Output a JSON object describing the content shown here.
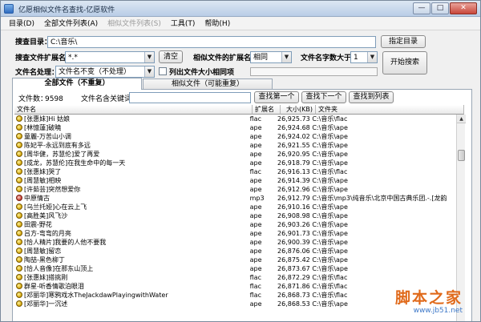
{
  "window": {
    "title": "亿愿相似文件名查找-亿愿软件",
    "min_label": "—",
    "max_label": "□",
    "close_label": "✕"
  },
  "menu": [
    {
      "label": "目录(D)",
      "enabled": true
    },
    {
      "label": "全部文件列表(A)",
      "enabled": true
    },
    {
      "label": "相似文件列表(S)",
      "enabled": false
    },
    {
      "label": "工具(T)",
      "enabled": true
    },
    {
      "label": "帮助(H)",
      "enabled": true
    }
  ],
  "form": {
    "search_dir_label": "搜查目录：",
    "search_dir_value": "C:\\音乐\\",
    "choose_dir_button": "指定目录",
    "ext_label": "搜查文件扩展名：",
    "ext_value": "*.*",
    "clear_button": "清空",
    "similar_ext_label": "相似文件的扩展名：",
    "similar_ext_value": "相同",
    "min_chars_label": "文件名字数大于：",
    "min_chars_value": "1",
    "start_button": "开始搜索",
    "name_proc_label": "文件名处理：",
    "name_proc_value": "文件名不变（不处理）",
    "list_same_size_label": "列出文件大小相同项",
    "list_same_size_checked": false,
    "progress": 0
  },
  "tabs": [
    {
      "label": "全部文件（不重复）",
      "active": true
    },
    {
      "label": "相似文件（可能重复）",
      "active": false
    }
  ],
  "list_info": {
    "file_count_label": "文件数：",
    "file_count_value": "9598",
    "keyword_label": "文件名含关键词：",
    "keyword_value": "",
    "find_first_button": "查找第一个",
    "find_next_button": "查找下一个",
    "find_to_list_button": "查找到列表"
  },
  "columns": [
    "文件名",
    "扩展名",
    "大小(KB)",
    "文件夹"
  ],
  "rows": [
    {
      "name": "[张惠妹]Hi 姑娘",
      "ext": "flac",
      "size": "26,925.73",
      "folder": "C:\\音乐\\flac",
      "type": "flac"
    },
    {
      "name": "[林憶蓮]破曉",
      "ext": "ape",
      "size": "26,924.68",
      "folder": "C:\\音乐\\ape",
      "type": "ape"
    },
    {
      "name": "童麗-万苦山小调",
      "ext": "ape",
      "size": "26,924.02",
      "folder": "C:\\音乐\\ape",
      "type": "ape"
    },
    {
      "name": "陈妃平-永远到底有多远",
      "ext": "ape",
      "size": "26,921.55",
      "folder": "C:\\音乐\\ape",
      "type": "ape"
    },
    {
      "name": "[周华健，苏慧伦]爱了再爱",
      "ext": "ape",
      "size": "26,920.95",
      "folder": "C:\\音乐\\ape",
      "type": "ape"
    },
    {
      "name": "[成龙，苏慧伦]在我生命中的每一天",
      "ext": "ape",
      "size": "26,918.79",
      "folder": "C:\\音乐\\ape",
      "type": "ape"
    },
    {
      "name": "[张惠妹]哭了",
      "ext": "flac",
      "size": "26,916.13",
      "folder": "C:\\音乐\\flac",
      "type": "flac"
    },
    {
      "name": "[周慧敏]相映",
      "ext": "ape",
      "size": "26,914.39",
      "folder": "C:\\音乐\\ape",
      "type": "ape"
    },
    {
      "name": "[许茹芸]突然想爱你",
      "ext": "ape",
      "size": "26,912.96",
      "folder": "C:\\音乐\\ape",
      "type": "ape"
    },
    {
      "name": "中原情古",
      "ext": "mp3",
      "size": "26,912.79",
      "folder": "C:\\音乐\\mp3\\纯音乐\\北京中国古典乐团.-.[龙韵",
      "type": "mp3"
    },
    {
      "name": "[乌兰托娅]心在云上飞",
      "ext": "ape",
      "size": "26,910.16",
      "folder": "C:\\音乐\\ape",
      "type": "ape"
    },
    {
      "name": "[高胜美]风飞沙",
      "ext": "ape",
      "size": "26,908.98",
      "folder": "C:\\音乐\\ape",
      "type": "ape"
    },
    {
      "name": "田震-野花",
      "ext": "ape",
      "size": "26,903.26",
      "folder": "C:\\音乐\\ape",
      "type": "ape"
    },
    {
      "name": "吕方-弯弯的月亮",
      "ext": "ape",
      "size": "26,901.73",
      "folder": "C:\\音乐\\ape",
      "type": "ape"
    },
    {
      "name": "[恰人精片]我要的人他不要我",
      "ext": "ape",
      "size": "26,900.39",
      "folder": "C:\\音乐\\ape",
      "type": "ape"
    },
    {
      "name": "[周慧敏]留恋",
      "ext": "ape",
      "size": "26,876.06",
      "folder": "C:\\音乐\\ape",
      "type": "ape"
    },
    {
      "name": "陶喆-黑色柳丁",
      "ext": "ape",
      "size": "26,875.42",
      "folder": "C:\\音乐\\ape",
      "type": "ape"
    },
    {
      "name": "[恰人音像]在那东山顶上",
      "ext": "ape",
      "size": "26,873.67",
      "folder": "C:\\音乐\\ape",
      "type": "ape"
    },
    {
      "name": "[张惠妹]搭挑刚",
      "ext": "flac",
      "size": "26,872.29",
      "folder": "C:\\音乐\\flac",
      "type": "flac"
    },
    {
      "name": "群星-听香情歌泊眼泪",
      "ext": "flac",
      "size": "26,871.86",
      "folder": "C:\\音乐\\flac",
      "type": "flac"
    },
    {
      "name": "[邓丽华]寒鸦戏水TheJackdawPlayingwithWater",
      "ext": "flac",
      "size": "26,868.73",
      "folder": "C:\\音乐\\flac",
      "type": "flac"
    },
    {
      "name": "[邓丽华]一沉述",
      "ext": "ape",
      "size": "26,868.53",
      "folder": "C:\\音乐\\ape",
      "type": "ape"
    }
  ],
  "watermark": {
    "big": "脚本之家",
    "small": "www.jb51.net"
  }
}
